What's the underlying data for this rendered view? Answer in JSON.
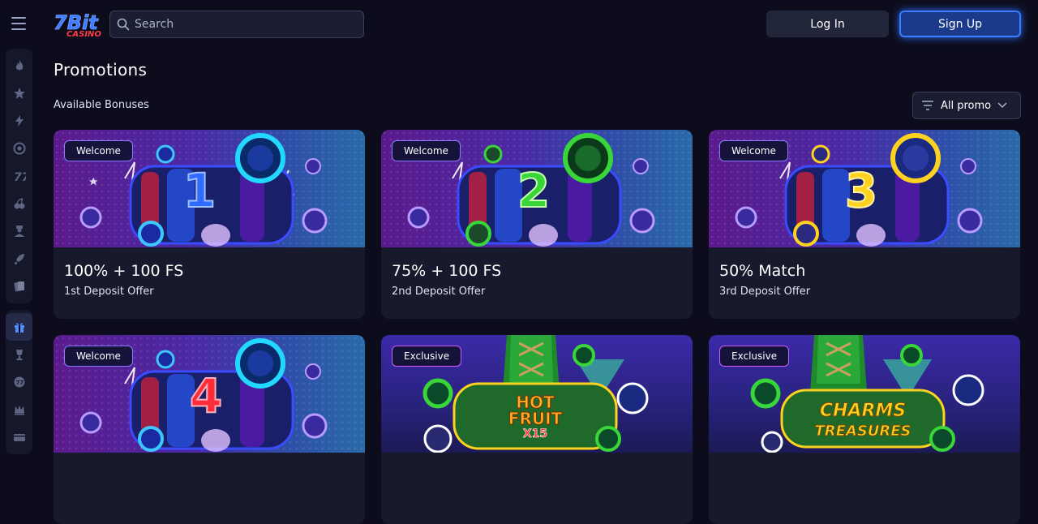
{
  "header": {
    "search_placeholder": "Search",
    "login_label": "Log In",
    "signup_label": "Sign Up",
    "logo_text": "7Bit CASINO"
  },
  "sidebar": {
    "items": [
      {
        "icon": "flame-icon"
      },
      {
        "icon": "star-icon"
      },
      {
        "icon": "lightning-icon"
      },
      {
        "icon": "target-icon"
      },
      {
        "icon": "seven-icon"
      },
      {
        "icon": "cherries-icon"
      },
      {
        "icon": "dealer-icon"
      },
      {
        "icon": "rocket-icon"
      },
      {
        "icon": "cards-icon"
      },
      {
        "icon": "gift-icon"
      },
      {
        "icon": "trophy-icon"
      },
      {
        "icon": "wheel-icon"
      },
      {
        "icon": "crown-icon"
      },
      {
        "icon": "wallet-icon"
      }
    ]
  },
  "main": {
    "title": "Promotions",
    "subtitle": "Available Bonuses",
    "filter_label": "All promo"
  },
  "cards": [
    {
      "badge": "Welcome",
      "offer": "100% + 100 FS",
      "desc": "1st Deposit Offer",
      "art_number": "1",
      "art_color": "#2f6bff"
    },
    {
      "badge": "Welcome",
      "offer": "75% + 100 FS",
      "desc": "2nd Deposit Offer",
      "art_number": "2",
      "art_color": "#39d63a"
    },
    {
      "badge": "Welcome",
      "offer": "50% Match",
      "desc": "3rd Deposit Offer",
      "art_number": "3",
      "art_color": "#ffd21f"
    },
    {
      "badge": "Welcome",
      "offer": "",
      "desc": "",
      "art_number": "4",
      "art_color": "#ff2d3a"
    },
    {
      "badge": "Exclusive",
      "offer": "",
      "desc": "",
      "art_title_1": "HOT",
      "art_title_2": "FRUIT",
      "art_title_3": "X15"
    },
    {
      "badge": "Exclusive",
      "offer": "",
      "desc": "",
      "art_title_1": "CHARMS",
      "art_title_2": "TREASURES"
    }
  ],
  "colors": {
    "background": "#0c0c1c",
    "card": "#171a2c",
    "accent": "#3d7bff"
  }
}
